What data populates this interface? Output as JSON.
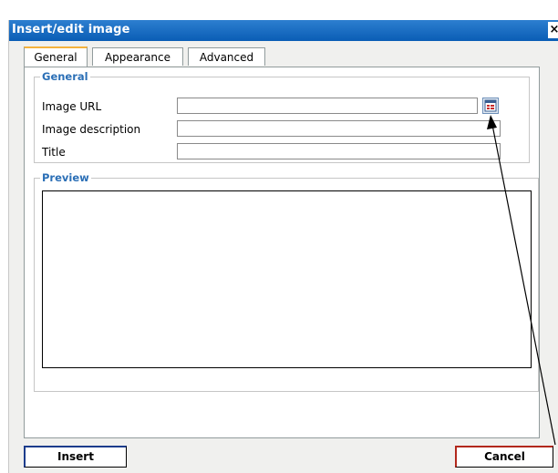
{
  "dialog": {
    "title": "Insert/edit image",
    "close_glyph": "×"
  },
  "tabs": [
    {
      "label": "General",
      "active": true
    },
    {
      "label": "Appearance",
      "active": false
    },
    {
      "label": "Advanced",
      "active": false
    }
  ],
  "general": {
    "legend": "General",
    "image_url_label": "Image URL",
    "image_url_value": "",
    "image_description_label": "Image description",
    "image_description_value": "",
    "title_label": "Title",
    "title_value": "",
    "browse_icon": "browse-icon"
  },
  "preview": {
    "legend": "Preview"
  },
  "buttons": {
    "insert": "Insert",
    "cancel": "Cancel"
  },
  "colors": {
    "titlebar": "#0a5db5",
    "legend_text": "#2b6fb6",
    "active_tab_accent": "#f4b23c"
  }
}
